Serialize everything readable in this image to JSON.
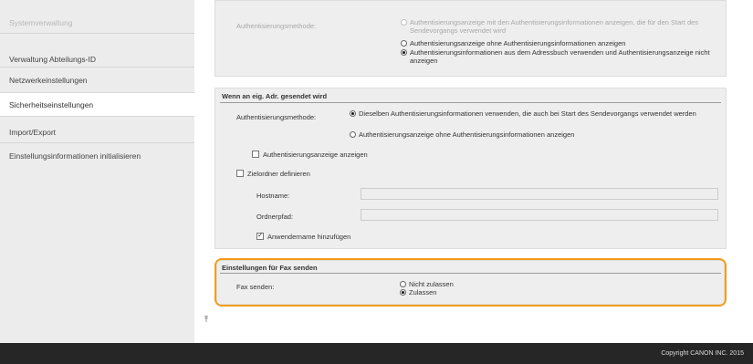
{
  "sidebar": {
    "items": [
      {
        "label": "Systemverwaltung"
      },
      {
        "label": "Verwaltung Abteilungs-ID"
      },
      {
        "label": "Netzwerkeinstellungen"
      },
      {
        "label": "Sicherheitseinstellungen"
      },
      {
        "label": "Import/Export"
      },
      {
        "label": "Einstellungsinformationen initialisieren"
      }
    ]
  },
  "auth_top": {
    "label": "Authentisierungsmethode:",
    "options": [
      "Authentisierungsanzeige mit den Authentisierungsinformationen anzeigen, die für den Start des Sendevorgangs verwendet wird",
      "Authentisierungsanzeige ohne Authentisierungsinformationen anzeigen",
      "Authentisierungsinformationen aus dem Adressbuch verwenden und Authentisierungsanzeige nicht anzeigen"
    ]
  },
  "send_section": {
    "heading": "Wenn an eig. Adr. gesendet wird",
    "auth_label": "Authentisierungsmethode:",
    "options": [
      "Dieselben Authentisierungsinformationen verwenden, die auch bei Start des Sendevorgangs verwendet werden",
      "Authentisierungsanzeige ohne Authentisierungsinformationen anzeigen"
    ],
    "show_auth_screen": "Authentisierungsanzeige anzeigen",
    "define_dest_folder": "Zielordner definieren",
    "hostname_label": "Hostname:",
    "folder_path_label": "Ordnerpfad:",
    "add_username": "Anwendername hinzufügen"
  },
  "fax_section": {
    "heading": "Einstellungen für Fax senden",
    "fax_label": "Fax senden:",
    "options": [
      "Nicht zulassen",
      "Zulassen"
    ]
  },
  "footer": {
    "copyright": "Copyright CANON INC. 2015"
  },
  "colors": {
    "highlight": "#f39c1a",
    "footer_bg": "#262626",
    "sidebar_bg": "#ececec"
  }
}
